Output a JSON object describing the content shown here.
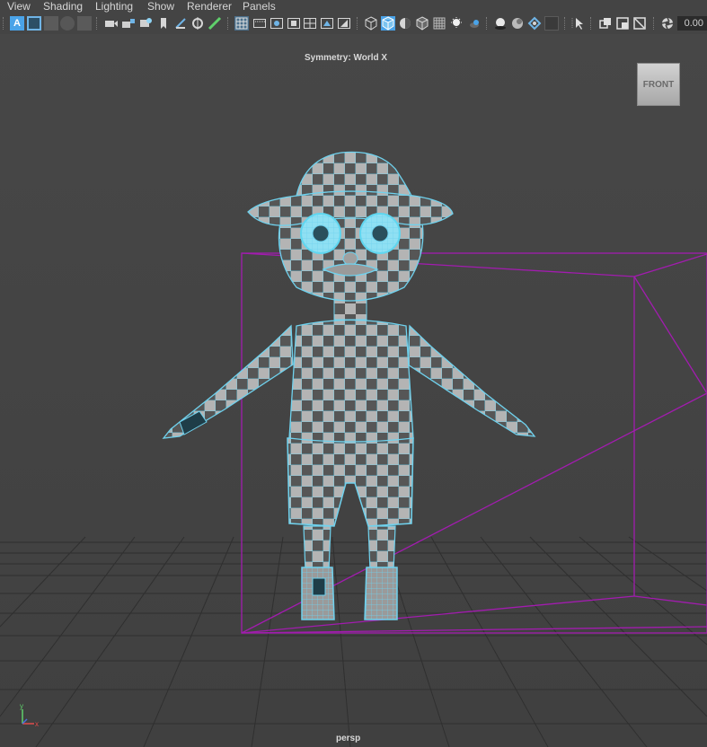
{
  "menubar": {
    "items": [
      "View",
      "Shading",
      "Lighting",
      "Show",
      "Renderer",
      "Panels"
    ]
  },
  "toolbar": {
    "icons": [
      "select-camera-icon",
      "camera-attributes-icon",
      "bookmarks-icon",
      "image-plane-icon",
      "film-gate-icon",
      "camera-icon",
      "lock-camera-icon",
      "camera-overscan-icon",
      "grease-pencil-icon",
      "2d-pan-zoom-icon",
      "draw-icon",
      "grid-icon",
      "film-gate-toggle-icon",
      "resolution-gate-icon",
      "gate-mask-icon",
      "field-chart-icon",
      "safe-action-icon",
      "wireframe-icon",
      "smooth-shade-icon",
      "default-material-icon",
      "wireframe-on-shaded-icon",
      "xray-icon",
      "use-all-lights-icon",
      "shadows-icon",
      "screen-space-ao-icon",
      "motion-blur-icon",
      "multisample-aa-icon",
      "depth-of-field-icon",
      "isolate-select-icon",
      "xray-joints-icon",
      "gamma-icon",
      "exposure-icon"
    ],
    "exposure_value": "0.00"
  },
  "viewport": {
    "symmetry_label": "Symmetry: World X",
    "viewcube_label": "FRONT",
    "camera_name": "persp",
    "axis_labels": {
      "x": "x",
      "y": "y"
    },
    "colors": {
      "background": "#444444",
      "grid": "#2e2e2e",
      "wireframe_selected": "#5fd6f0",
      "camera_frustum": "#a21caf",
      "checker_light": "#b0b0b0",
      "checker_dark": "#555555"
    }
  }
}
